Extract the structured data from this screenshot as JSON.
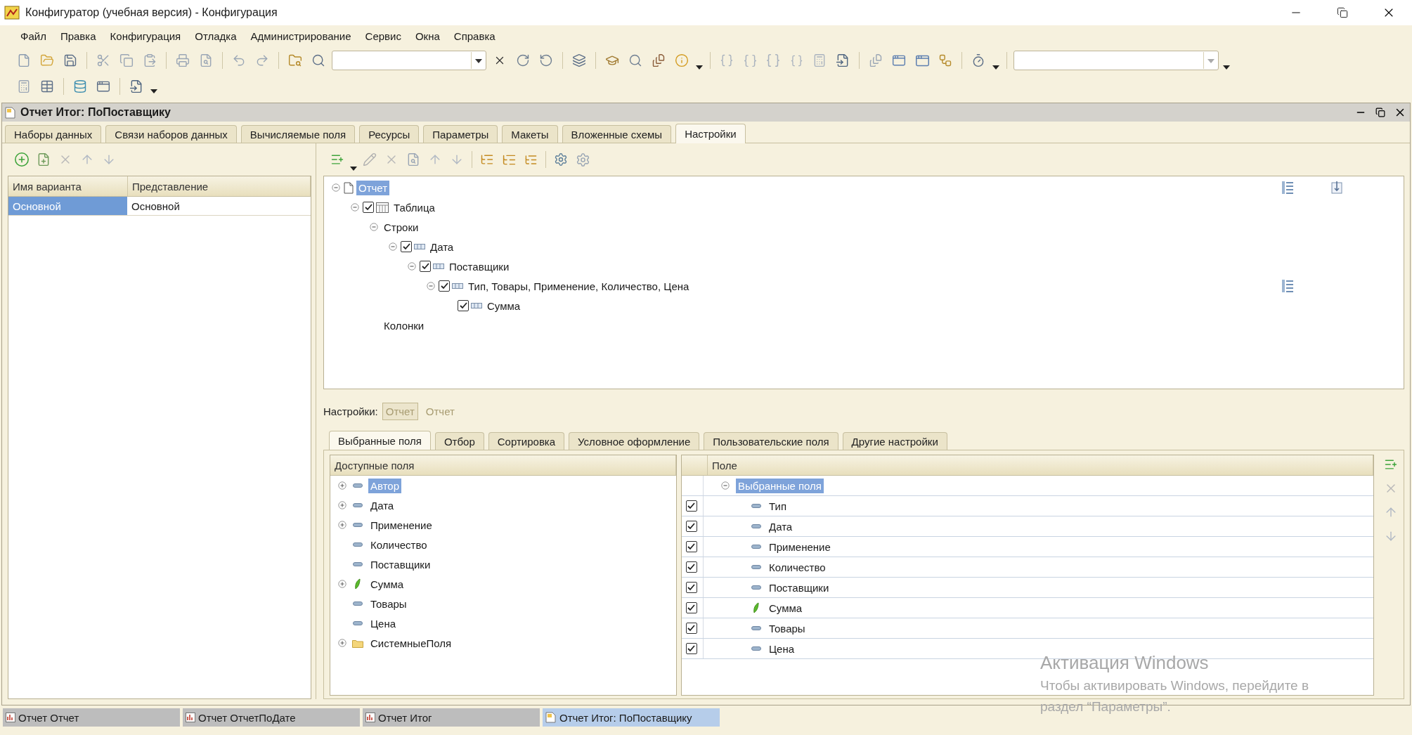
{
  "window": {
    "title": "Конфигуратор (учебная версия) - Конфигурация"
  },
  "menu": [
    "Файл",
    "Правка",
    "Конфигурация",
    "Отладка",
    "Администрирование",
    "Сервис",
    "Окна",
    "Справка"
  ],
  "document": {
    "title": "Отчет Итог: ПоПоставщику"
  },
  "tabs": [
    {
      "label": "Наборы данных",
      "selected": false
    },
    {
      "label": "Связи наборов данных",
      "selected": false
    },
    {
      "label": "Вычисляемые поля",
      "selected": false
    },
    {
      "label": "Ресурсы",
      "selected": false
    },
    {
      "label": "Параметры",
      "selected": false
    },
    {
      "label": "Макеты",
      "selected": false
    },
    {
      "label": "Вложенные схемы",
      "selected": false
    },
    {
      "label": "Настройки",
      "selected": true
    }
  ],
  "variants": {
    "columns": [
      "Имя варианта",
      "Представление"
    ],
    "rows": [
      {
        "cells": [
          "Основной",
          "Основной"
        ],
        "selected": true
      }
    ]
  },
  "structure": {
    "tree": [
      {
        "label": "Отчет",
        "kind": "report",
        "selected": true,
        "expanded": true,
        "settings_icon": true,
        "pin_icon": true,
        "children": [
          {
            "label": "Таблица",
            "kind": "table",
            "checked": true,
            "expanded": true,
            "children": [
              {
                "label": "Строки",
                "kind": "group",
                "expanded": true,
                "children": [
                  {
                    "label": "Дата",
                    "kind": "grouping",
                    "checked": true,
                    "expanded": true,
                    "children": [
                      {
                        "label": "Поставщики",
                        "kind": "grouping",
                        "checked": true,
                        "expanded": true,
                        "children": [
                          {
                            "label": "Тип, Товары, Применение, Количество, Цена",
                            "kind": "grouping",
                            "checked": true,
                            "expanded": true,
                            "settings_icon": true,
                            "children": [
                              {
                                "label": "Сумма",
                                "kind": "grouping",
                                "checked": true
                              }
                            ]
                          }
                        ]
                      }
                    ]
                  }
                ]
              },
              {
                "label": "Колонки",
                "kind": "group"
              }
            ]
          }
        ]
      }
    ]
  },
  "settings_bar": {
    "label": "Настройки:",
    "buttons": [
      {
        "label": "Отчет",
        "selected": true
      },
      {
        "label": "Отчет",
        "selected": false
      }
    ]
  },
  "subtabs": [
    {
      "label": "Выбранные поля",
      "selected": true
    },
    {
      "label": "Отбор",
      "selected": false
    },
    {
      "label": "Сортировка",
      "selected": false
    },
    {
      "label": "Условное оформление",
      "selected": false
    },
    {
      "label": "Пользовательские поля",
      "selected": false
    },
    {
      "label": "Другие настройки",
      "selected": false
    }
  ],
  "available_fields": {
    "header": "Доступные поля",
    "items": [
      {
        "label": "Автор",
        "kind": "field",
        "expandable": true,
        "selected": true
      },
      {
        "label": "Дата",
        "kind": "field",
        "expandable": true,
        "selected": false
      },
      {
        "label": "Применение",
        "kind": "field",
        "expandable": true,
        "selected": false
      },
      {
        "label": "Количество",
        "kind": "field",
        "expandable": false,
        "selected": false
      },
      {
        "label": "Поставщики",
        "kind": "field",
        "expandable": false,
        "selected": false
      },
      {
        "label": "Сумма",
        "kind": "resource",
        "expandable": true,
        "selected": false
      },
      {
        "label": "Товары",
        "kind": "field",
        "expandable": false,
        "selected": false
      },
      {
        "label": "Цена",
        "kind": "field",
        "expandable": false,
        "selected": false
      },
      {
        "label": "СистемныеПоля",
        "kind": "folder",
        "expandable": true,
        "selected": false
      }
    ]
  },
  "selected_fields": {
    "header": "Поле",
    "root": {
      "label": "Выбранные поля",
      "selected": true,
      "expanded": true
    },
    "rows": [
      {
        "label": "Тип",
        "kind": "field",
        "checked": true
      },
      {
        "label": "Дата",
        "kind": "field",
        "checked": true
      },
      {
        "label": "Применение",
        "kind": "field",
        "checked": true
      },
      {
        "label": "Количество",
        "kind": "field",
        "checked": true
      },
      {
        "label": "Поставщики",
        "kind": "field",
        "checked": true
      },
      {
        "label": "Сумма",
        "kind": "resource",
        "checked": true
      },
      {
        "label": "Товары",
        "kind": "field",
        "checked": true
      },
      {
        "label": "Цена",
        "kind": "field",
        "checked": true
      }
    ]
  },
  "activation_notice": {
    "title": "Активация Windows",
    "text": "Чтобы активировать Windows, перейдите в раздел “Параметры”."
  },
  "taskbar": [
    {
      "label": "Отчет Отчет",
      "kind": "report",
      "selected": false
    },
    {
      "label": "Отчет ОтчетПоДате",
      "kind": "report",
      "selected": false
    },
    {
      "label": "Отчет Итог",
      "kind": "report",
      "selected": false
    },
    {
      "label": "Отчет Итог: ПоПоставщику",
      "kind": "schema",
      "selected": true
    }
  ]
}
